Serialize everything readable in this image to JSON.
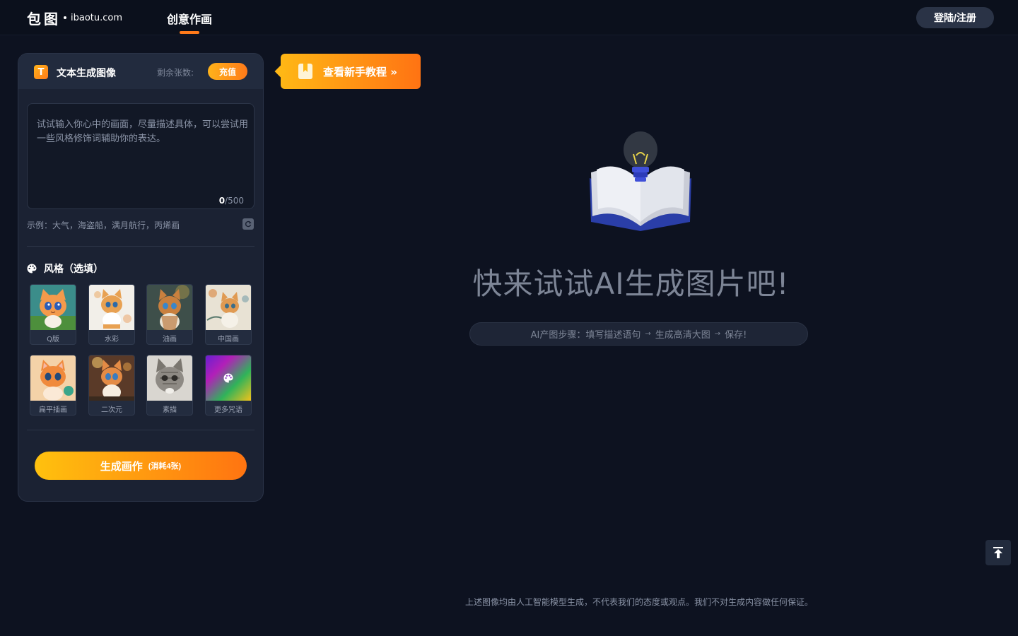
{
  "header": {
    "logo_mark": "包图",
    "logo_domain": "ibaotu.com",
    "nav_tab": "创意作画",
    "login_label": "登陆/注册"
  },
  "panel": {
    "title": "文本生成图像",
    "title_icon": "T",
    "remain_label": "剩余张数:",
    "recharge_label": "充值",
    "prompt_placeholder": "试试输入你心中的画面，尽量描述具体，可以尝试用一些风格修饰词辅助你的表达。",
    "counter_current": "0",
    "counter_max": "/500",
    "example_text": "示例：大气，海盗船，满月航行，丙烯画",
    "style_title": "风格（选填）",
    "styles": [
      {
        "label": "Q版"
      },
      {
        "label": "水彩"
      },
      {
        "label": "油画"
      },
      {
        "label": "中国画"
      },
      {
        "label": "扁平插画"
      },
      {
        "label": "二次元"
      },
      {
        "label": "素描"
      },
      {
        "label": "更多咒语"
      }
    ],
    "generate_label": "生成画作",
    "generate_sub": "(消耗4张)"
  },
  "tutorial": {
    "label": "查看新手教程 »"
  },
  "hero": {
    "title": "快来试试AI生成图片吧!",
    "steps": {
      "prefix": "AI产图步骤：填写描述语句",
      "step2": "生成高清大图",
      "step3": "保存!"
    }
  },
  "footer": {
    "disclaimer": "上述图像均由人工智能模型生成，不代表我们的态度或观点。我们不对生成内容做任何保证。"
  },
  "colors": {
    "accent_orange": "#ff7a1a",
    "accent_yellow": "#ffb31a",
    "page_bg": "#0d1220",
    "panel_bg": "#1b2233"
  }
}
